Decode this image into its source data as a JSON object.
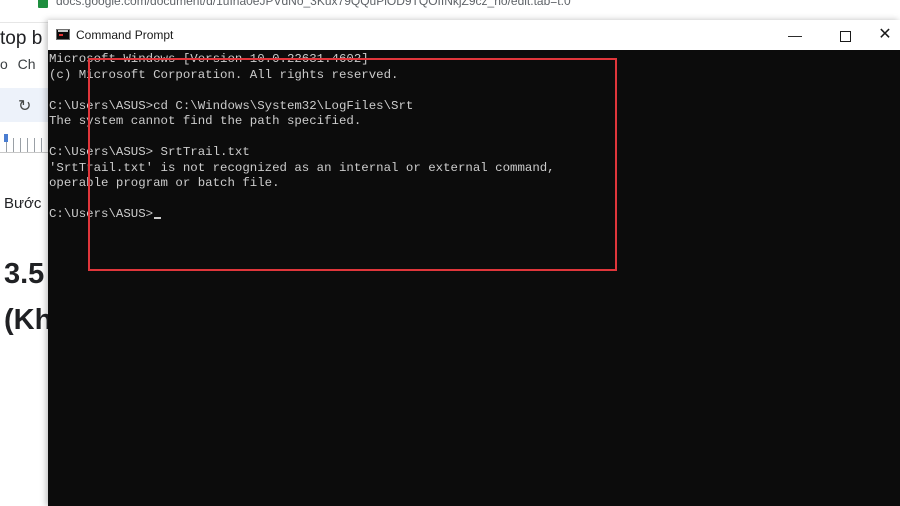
{
  "background_app": {
    "url_fragment": "docs.google.com/document/d/1uIha0eJPVdNo_3Kux79QQuPiOD9TQOIINkjZ9cz_ho/edit.tab=t.0",
    "doc_title_fragment": "top b",
    "menu_fragment": "o Ch",
    "step_text_fragment": "Bước",
    "heading_fragment_1": "3.5",
    "heading_fragment_2": "(Kh",
    "redo_icon": "redo-icon"
  },
  "cmd_window": {
    "title": "Command Prompt",
    "minimize_glyph": "—",
    "close_glyph": "✕",
    "lines": [
      "Microsoft Windows [Version 10.0.22631.4602]",
      "(c) Microsoft Corporation. All rights reserved.",
      "",
      "C:\\Users\\ASUS>cd C:\\Windows\\System32\\LogFiles\\Srt",
      "The system cannot find the path specified.",
      "",
      "C:\\Users\\ASUS> SrtTrail.txt",
      "'SrtTrail.txt' is not recognized as an internal or external command,",
      "operable program or batch file.",
      "",
      "C:\\Users\\ASUS>"
    ]
  },
  "colors": {
    "console_bg": "#0c0c0c",
    "console_text": "#cccccc",
    "highlight_border": "#e0363b"
  }
}
